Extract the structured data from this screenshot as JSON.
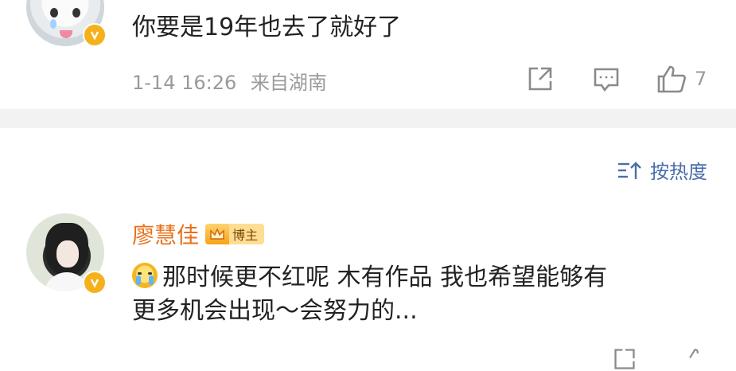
{
  "comment1": {
    "text": "你要是19年也去了就好了",
    "time": "1-14 16:26",
    "location": "来自湖南",
    "like_count": "7"
  },
  "sort": {
    "label": "按热度"
  },
  "comment2": {
    "username": "廖慧佳",
    "badge_label": "博主",
    "text_line1": "那时候更不红呢 木有作品 我也希望能够有",
    "text_line2": "更多机会出现～会努力的..."
  },
  "icons": {
    "share": "share-icon",
    "reply": "comment-icon",
    "like": "thumbs-up-icon",
    "sort": "sort-icon",
    "verified": "verified-badge-icon",
    "crown": "crown-icon",
    "emoji": "crying-emoji-icon"
  },
  "colors": {
    "username": "#e8711a",
    "link": "#4a6ea8",
    "verified": "#f5b11c",
    "divider": "#f2f2f2"
  }
}
